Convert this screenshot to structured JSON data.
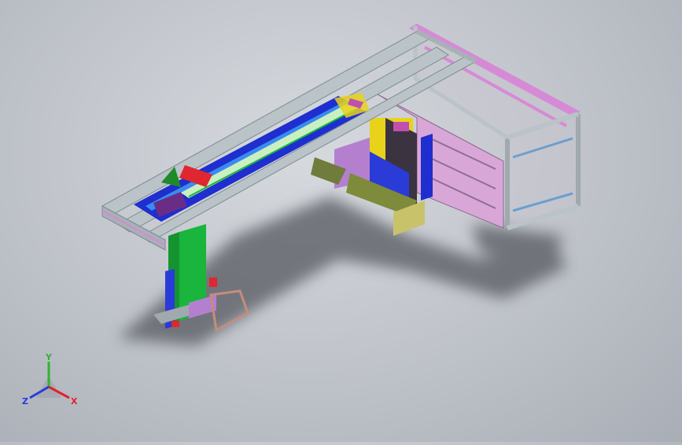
{
  "viewport": {
    "background_top": "#d6d9de",
    "background_bottom": "#a9aeb6"
  },
  "model": {
    "colors": {
      "frame": "#b9c3c8",
      "frame_edge": "#7e8b92",
      "blue_rail": "#1f2ecf",
      "green_column": "#19b53c",
      "purple": "#b57fd0",
      "pink_frame": "#d68ad6",
      "yellow": "#e8d21a",
      "red_carriage": "#e0262e",
      "dark_plate": "#3b3340",
      "shadow": "#5b5e64"
    }
  },
  "triad": {
    "x_label": "X",
    "y_label": "Y",
    "z_label": "Z",
    "x_color": "#e4222b",
    "y_color": "#2fb52f",
    "z_color": "#2a3bd8"
  }
}
